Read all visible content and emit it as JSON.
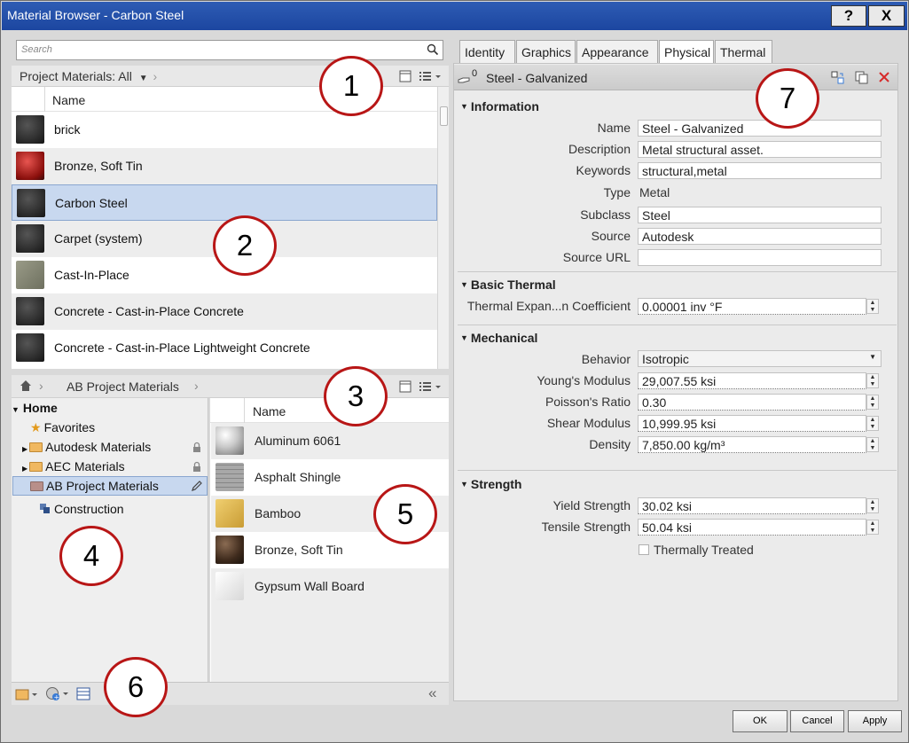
{
  "window": {
    "title": "Material Browser - Carbon Steel",
    "help_label": "?",
    "close_label": "X"
  },
  "search": {
    "placeholder": "Search"
  },
  "project_materials": {
    "filter_label": "Project Materials: All",
    "column_name": "Name",
    "items": [
      {
        "name": "brick",
        "swatch": "#2a2a2a"
      },
      {
        "name": "Bronze, Soft Tin",
        "swatch": "#b2201d"
      },
      {
        "name": "Carbon Steel",
        "swatch": "#2a2a2a",
        "selected": true
      },
      {
        "name": "Carpet (system)",
        "swatch": "#2a2a2a"
      },
      {
        "name": "Cast-In-Place",
        "swatch": "#8a8a78"
      },
      {
        "name": "Concrete - Cast-in-Place Concrete",
        "swatch": "#2a2a2a"
      },
      {
        "name": "Concrete - Cast-in-Place Lightweight Concrete",
        "swatch": "#2a2a2a"
      }
    ]
  },
  "library": {
    "breadcrumb": "AB Project Materials",
    "column_name": "Name",
    "tree": {
      "home": "Home",
      "favorites": "Favorites",
      "autodesk": "Autodesk Materials",
      "aec": "AEC Materials",
      "ab_project": "AB Project Materials",
      "construction": "Construction"
    },
    "items": [
      {
        "name": "Aluminum 6061",
        "swatch": "#c8c8c8"
      },
      {
        "name": "Asphalt Shingle",
        "swatch": "#9a9a9a"
      },
      {
        "name": "Bamboo",
        "swatch": "#d8b55a"
      },
      {
        "name": "Bronze, Soft Tin",
        "swatch": "#4a3526"
      },
      {
        "name": "Gypsum Wall Board",
        "swatch": "#e6e6e6"
      }
    ]
  },
  "tabs": [
    "Identity",
    "Graphics",
    "Appearance",
    "Physical",
    "Thermal"
  ],
  "active_tab": "Physical",
  "asset": {
    "usage_count": "0",
    "name": "Steel - Galvanized",
    "information": {
      "title": "Information",
      "name_label": "Name",
      "name_value": "Steel - Galvanized",
      "description_label": "Description",
      "description_value": "Metal structural asset.",
      "keywords_label": "Keywords",
      "keywords_value": "structural,metal",
      "type_label": "Type",
      "type_value": "Metal",
      "subclass_label": "Subclass",
      "subclass_value": "Steel",
      "source_label": "Source",
      "source_value": "Autodesk",
      "source_url_label": "Source URL",
      "source_url_value": ""
    },
    "basic_thermal": {
      "title": "Basic Thermal",
      "expansion_label": "Thermal Expan...n Coefficient",
      "expansion_value": "0.00001 inv °F"
    },
    "mechanical": {
      "title": "Mechanical",
      "behavior_label": "Behavior",
      "behavior_value": "Isotropic",
      "youngs_label": "Young's Modulus",
      "youngs_value": "29,007.55 ksi",
      "poisson_label": "Poisson's Ratio",
      "poisson_value": "0.30",
      "shear_label": "Shear Modulus",
      "shear_value": "10,999.95 ksi",
      "density_label": "Density",
      "density_value": "7,850.00 kg/m³"
    },
    "strength": {
      "title": "Strength",
      "yield_label": "Yield Strength",
      "yield_value": "30.02 ksi",
      "tensile_label": "Tensile Strength",
      "tensile_value": "50.04 ksi",
      "treated_label": "Thermally Treated"
    }
  },
  "buttons": {
    "ok": "OK",
    "cancel": "Cancel",
    "apply": "Apply"
  },
  "callouts": [
    "1",
    "2",
    "3",
    "4",
    "5",
    "6",
    "7"
  ],
  "colors": {
    "title_bar": "#1c46a0",
    "selection": "#c8d8ef",
    "callout_ring": "#b81616"
  }
}
